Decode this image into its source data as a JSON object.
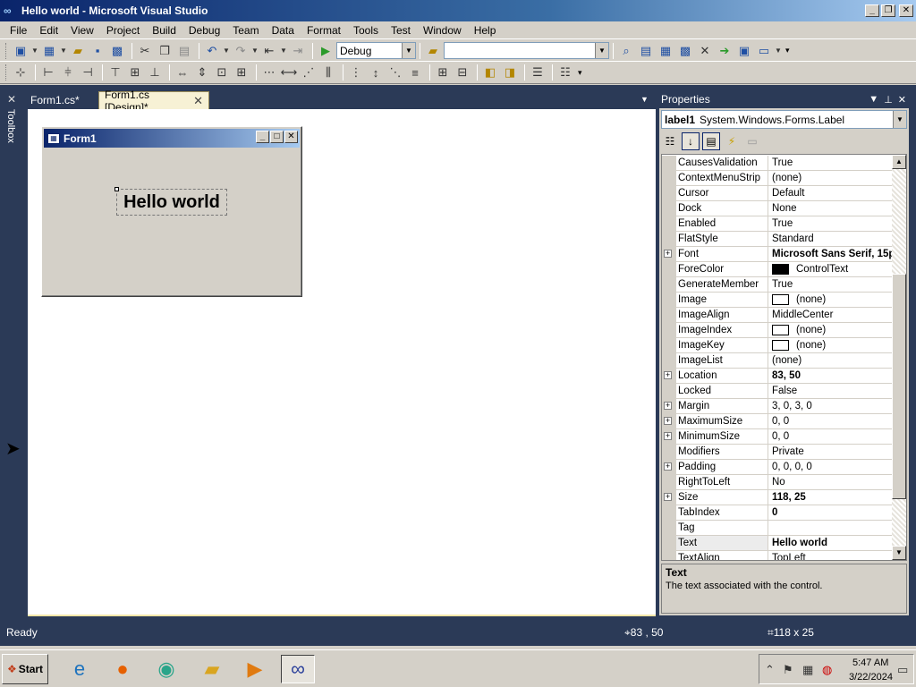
{
  "window": {
    "title": "Hello world - Microsoft Visual Studio",
    "app_icon": "visual-studio-icon",
    "buttons": {
      "minimize": "_",
      "maximize": "❐",
      "close": "✕"
    }
  },
  "menu": [
    "File",
    "Edit",
    "View",
    "Project",
    "Build",
    "Debug",
    "Team",
    "Data",
    "Format",
    "Tools",
    "Test",
    "Window",
    "Help"
  ],
  "toolbar": {
    "config_value": "Debug",
    "find_value": ""
  },
  "toolbox": {
    "label": "Toolbox"
  },
  "tabs": [
    {
      "label": "Form1.cs*"
    },
    {
      "label": "Form1.cs [Design]*",
      "close": "✕"
    }
  ],
  "designer": {
    "form_title": "Form1",
    "label_text": "Hello world"
  },
  "properties": {
    "header": "Properties",
    "object_name": "label1",
    "object_type": "System.Windows.Forms.Label",
    "rows": [
      {
        "name": "CausesValidation",
        "value": "True",
        "expand": false,
        "bold": false
      },
      {
        "name": "ContextMenuStrip",
        "value": "(none)",
        "expand": false,
        "bold": false
      },
      {
        "name": "Cursor",
        "value": "Default",
        "expand": false,
        "bold": false
      },
      {
        "name": "Dock",
        "value": "None",
        "expand": false,
        "bold": false
      },
      {
        "name": "Enabled",
        "value": "True",
        "expand": false,
        "bold": false
      },
      {
        "name": "FlatStyle",
        "value": "Standard",
        "expand": false,
        "bold": false
      },
      {
        "name": "Font",
        "value": "Microsoft Sans Serif, 15pt",
        "expand": true,
        "bold": true
      },
      {
        "name": "ForeColor",
        "value": "ControlText",
        "expand": false,
        "bold": false,
        "swatch": "#000000"
      },
      {
        "name": "GenerateMember",
        "value": "True",
        "expand": false,
        "bold": false
      },
      {
        "name": "Image",
        "value": "(none)",
        "expand": false,
        "bold": false,
        "swatch": "#ffffff"
      },
      {
        "name": "ImageAlign",
        "value": "MiddleCenter",
        "expand": false,
        "bold": false
      },
      {
        "name": "ImageIndex",
        "value": "(none)",
        "expand": false,
        "bold": false,
        "swatch": "#ffffff"
      },
      {
        "name": "ImageKey",
        "value": "(none)",
        "expand": false,
        "bold": false,
        "swatch": "#ffffff"
      },
      {
        "name": "ImageList",
        "value": "(none)",
        "expand": false,
        "bold": false
      },
      {
        "name": "Location",
        "value": "83, 50",
        "expand": true,
        "bold": true
      },
      {
        "name": "Locked",
        "value": "False",
        "expand": false,
        "bold": false
      },
      {
        "name": "Margin",
        "value": "3, 0, 3, 0",
        "expand": true,
        "bold": false
      },
      {
        "name": "MaximumSize",
        "value": "0, 0",
        "expand": true,
        "bold": false
      },
      {
        "name": "MinimumSize",
        "value": "0, 0",
        "expand": true,
        "bold": false
      },
      {
        "name": "Modifiers",
        "value": "Private",
        "expand": false,
        "bold": false
      },
      {
        "name": "Padding",
        "value": "0, 0, 0, 0",
        "expand": true,
        "bold": false
      },
      {
        "name": "RightToLeft",
        "value": "No",
        "expand": false,
        "bold": false
      },
      {
        "name": "Size",
        "value": "118, 25",
        "expand": true,
        "bold": true
      },
      {
        "name": "TabIndex",
        "value": "0",
        "expand": false,
        "bold": true
      },
      {
        "name": "Tag",
        "value": "",
        "expand": false,
        "bold": false
      },
      {
        "name": "Text",
        "value": "Hello world",
        "expand": false,
        "bold": true,
        "selected": true
      },
      {
        "name": "TextAlign",
        "value": "TopLeft",
        "expand": false,
        "bold": false
      }
    ],
    "description_title": "Text",
    "description_text": "The text associated with the control."
  },
  "status": {
    "ready": "Ready",
    "position": "83 , 50",
    "size": "118 x 25"
  },
  "taskbar": {
    "start": "Start",
    "apps": [
      "internet-explorer-icon",
      "firefox-icon",
      "chat-icon",
      "file-explorer-icon",
      "media-player-icon",
      "visual-studio-icon"
    ],
    "time": "5:47 AM",
    "date": "3/22/2024"
  }
}
